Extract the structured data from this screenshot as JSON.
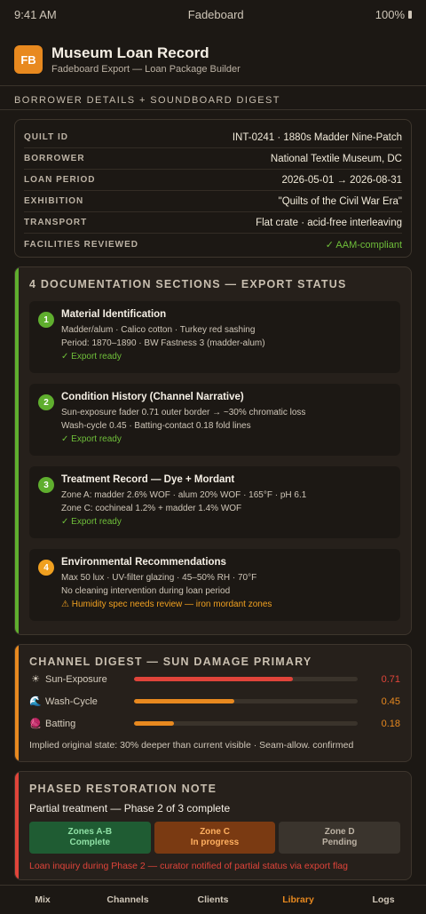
{
  "status_bar": {
    "time": "9:41 AM",
    "app": "Fadeboard",
    "battery": "100%"
  },
  "header": {
    "logo": "FB",
    "title": "Museum Loan Record",
    "subtitle": "Fadeboard Export — Loan Package Builder"
  },
  "borrower": {
    "heading": "BORROWER DETAILS + SOUNDBOARD DIGEST",
    "rows": [
      {
        "key": "QUILT ID",
        "value": "INT-0241 · 1880s Madder Nine-Patch"
      },
      {
        "key": "BORROWER",
        "value": "National Textile Museum, DC"
      },
      {
        "key": "LOAN PERIOD",
        "value": "2026-05-01 → 2026-08-31"
      },
      {
        "key": "EXHIBITION",
        "value": "\"Quilts of the Civil War Era\""
      },
      {
        "key": "TRANSPORT",
        "value": "Flat crate · acid-free interleaving"
      },
      {
        "key": "FACILITIES REVIEWED",
        "value": "✓ AAM-compliant"
      }
    ]
  },
  "docs": {
    "title": "4 DOCUMENTATION SECTIONS — EXPORT STATUS",
    "accent": "#5fae2e",
    "items": [
      {
        "num": "1",
        "title": "Material Identification",
        "line1": "Madder/alum · Calico cotton · Turkey red sashing",
        "line2": "Period: 1870–1890 · BW Fastness 3 (madder-alum)",
        "status": "✓ Export ready",
        "color": "#5fae2e"
      },
      {
        "num": "2",
        "title": "Condition History (Channel Narrative)",
        "line1": "Sun-exposure fader 0.71 outer border → ~30% chromatic loss",
        "line2": "Wash-cycle 0.45 · Batting-contact 0.18 fold lines",
        "status": "✓ Export ready",
        "color": "#5fae2e"
      },
      {
        "num": "3",
        "title": "Treatment Record — Dye + Mordant",
        "line1": "Zone A: madder 2.6% WOF · alum 20% WOF · 165°F · pH 6.1",
        "line2": "Zone C: cochineal 1.2% + madder 1.4% WOF",
        "status": "✓ Export ready",
        "color": "#5fae2e"
      },
      {
        "num": "4",
        "title": "Environmental Recommendations",
        "line1": "Max 50 lux · UV-filter glazing · 45–50% RH · 70°F",
        "line2": "No cleaning intervention during loan period",
        "status": "⚠ Humidity spec needs review — iron mordant zones",
        "color": "#f0a020"
      }
    ]
  },
  "digest": {
    "title": "CHANNEL DIGEST — SUN DAMAGE PRIMARY",
    "accent": "#e8891f",
    "meters": [
      {
        "icon": "☀",
        "label": "Sun-Exposure",
        "value": "0.71",
        "fraction": 0.71,
        "color": "#e0443a"
      },
      {
        "icon": "🌊",
        "label": "Wash-Cycle",
        "value": "0.45",
        "fraction": 0.45,
        "color": "#e8891f"
      },
      {
        "icon": "🧶",
        "label": "Batting",
        "value": "0.18",
        "fraction": 0.18,
        "color": "#e8891f"
      }
    ],
    "note": "Implied original state: 30% deeper than current visible · Seam-allow. confirmed"
  },
  "phase": {
    "title": "PHASED RESTORATION NOTE",
    "accent": "#e0443a",
    "subtitle": "Partial treatment — Phase 2 of 3 complete",
    "zones": [
      {
        "name": "Zones A-B",
        "status": "Complete",
        "bg": "#1f5c33",
        "fg": "#8fe0a5"
      },
      {
        "name": "Zone C",
        "status": "In progress",
        "bg": "#7a3a12",
        "fg": "#ffb060"
      },
      {
        "name": "Zone D",
        "status": "Pending",
        "bg": "#3a342d",
        "fg": "#bcb2a4"
      }
    ],
    "alert": "Loan inquiry during Phase 2 — curator notified of partial status via export flag"
  },
  "nav": {
    "items": [
      "Mix",
      "Channels",
      "Clients",
      "Library",
      "Logs"
    ],
    "active": "Library"
  }
}
